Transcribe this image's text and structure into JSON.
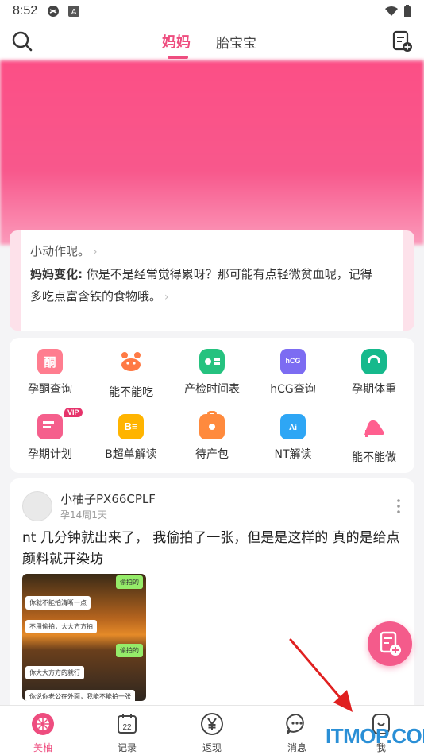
{
  "status_bar": {
    "time": "8:52"
  },
  "header": {
    "tab_active": "妈妈",
    "tab_other": "胎宝宝"
  },
  "hero_card": {
    "line1": "小动作呢。",
    "line2_label": "妈妈变化:",
    "line2_text": "你是不是经常觉得累呀？那可能有点轻微贫血呢，记得",
    "line3_text": "多吃点富含铁的食物哦。"
  },
  "tools": [
    {
      "label": "孕酮查询",
      "icon": "progesterone-icon",
      "color": "#ff7d8f"
    },
    {
      "label": "能不能吃",
      "icon": "crab-icon",
      "color": "#ff7a45"
    },
    {
      "label": "产检时间表",
      "icon": "checkup-schedule-icon",
      "color": "#25c27f"
    },
    {
      "label": "hCG查询",
      "icon": "hcg-icon",
      "color": "#7c6cf2"
    },
    {
      "label": "孕期体重",
      "icon": "scale-icon",
      "color": "#16b98c"
    },
    {
      "label": "孕期计划",
      "icon": "plan-icon",
      "color": "#f55f8c",
      "badge": "VIP"
    },
    {
      "label": "B超单解读",
      "icon": "ultrasound-icon",
      "color": "#ffb400"
    },
    {
      "label": "待产包",
      "icon": "bag-icon",
      "color": "#ff8a3d"
    },
    {
      "label": "NT解读",
      "icon": "nt-ai-icon",
      "color": "#2ea6f5"
    },
    {
      "label": "能不能做",
      "icon": "high-heel-icon",
      "color": "#ff5f8f"
    }
  ],
  "post": {
    "username": "小柚子PX66CPLF",
    "meta": "孕14周1天",
    "text": "nt 几分钟就出来了， 我偷拍了一张，但是是这样的 真的是给点颜料就开染坊",
    "image_bubbles": [
      {
        "text": "偷拍的",
        "side": "right"
      },
      {
        "text": "你就不能拍清晰一点",
        "side": "left"
      },
      {
        "text": "不用偷拍，大大方方拍",
        "side": "left"
      },
      {
        "text": "偷拍的",
        "side": "right"
      },
      {
        "text": "你大大方方的就行",
        "side": "left"
      },
      {
        "text": "你说你老公在外面，我能不能拍一张",
        "side": "left"
      }
    ]
  },
  "bottom_nav": [
    {
      "label": "美柚",
      "icon": "meiyou-icon",
      "active": true
    },
    {
      "label": "记录",
      "icon": "calendar-icon",
      "day": "22"
    },
    {
      "label": "返现",
      "icon": "yen-icon"
    },
    {
      "label": "消息",
      "icon": "message-icon"
    },
    {
      "label": "我",
      "icon": "me-icon"
    }
  ],
  "watermark": "ITMOP.COM",
  "colors": {
    "accent": "#ee4d7f",
    "fab": "#f45b8b",
    "arrow": "#e02020"
  }
}
